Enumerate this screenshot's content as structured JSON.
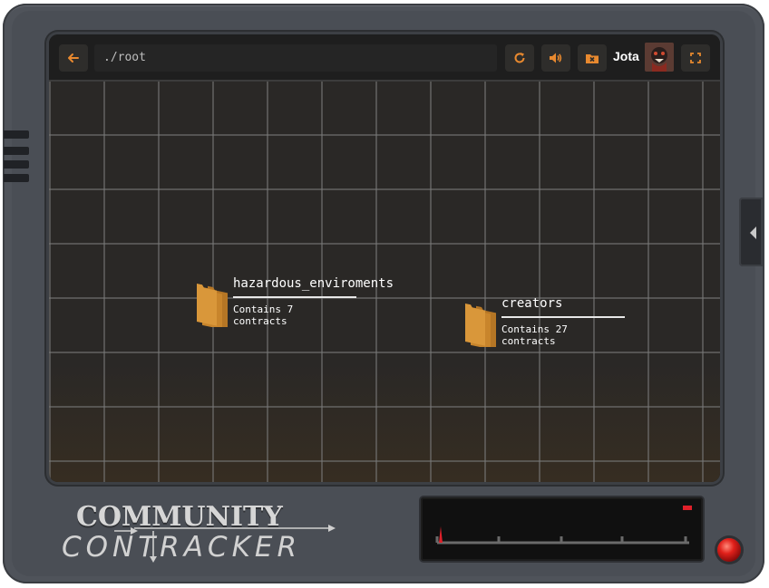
{
  "toolbar": {
    "path": "./root",
    "user_name": "Jota"
  },
  "icons": {
    "back": "arrow-left-icon",
    "refresh": "refresh-icon",
    "sound": "speaker-icon",
    "folder_remove": "folder-x-icon",
    "fullscreen": "fullscreen-icon",
    "folder": "folder-stack-icon"
  },
  "folders": [
    {
      "name": "hazardous_enviroments",
      "description": "Contains 7 contracts"
    },
    {
      "name": "creators",
      "description": "Contains 27 contracts"
    }
  ],
  "logo": {
    "top": "COMMUNITY",
    "bottom": "CONTRACKER"
  },
  "colors": {
    "accent": "#e8892f",
    "folder": "#d9973a",
    "indicator": "#e0202a"
  }
}
